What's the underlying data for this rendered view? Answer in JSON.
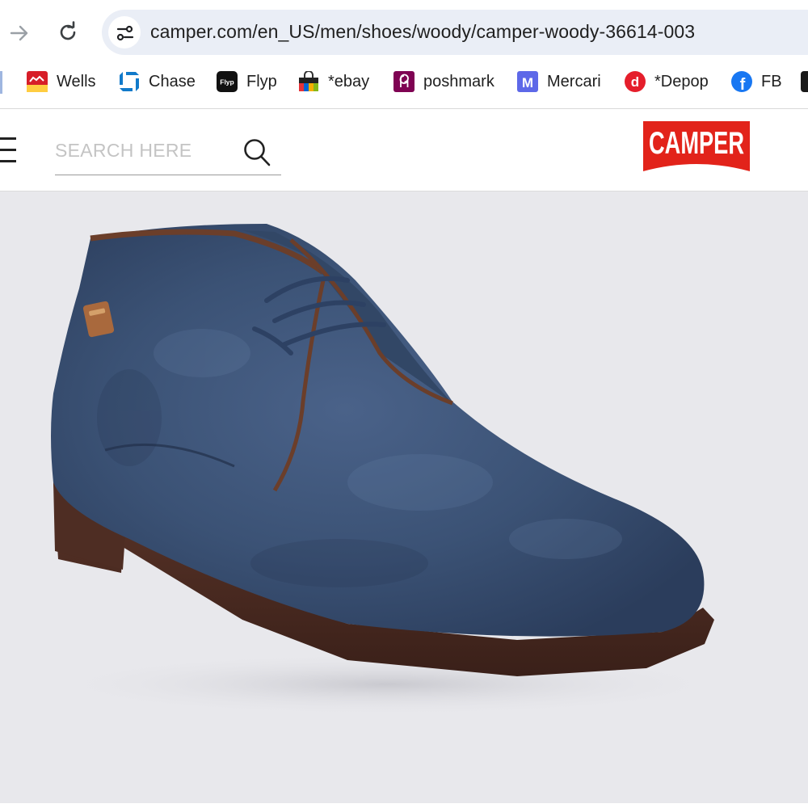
{
  "browser": {
    "url": "camper.com/en_US/men/shoes/woody/camper-woody-36614-003",
    "bookmarks": [
      {
        "label": "Wells",
        "icon": "wells-fargo-icon"
      },
      {
        "label": "Chase",
        "icon": "chase-icon"
      },
      {
        "label": "Flyp",
        "icon": "flyp-icon",
        "icon_text": "Flyp"
      },
      {
        "label": "*ebay",
        "icon": "ebay-icon"
      },
      {
        "label": "poshmark",
        "icon": "poshmark-icon"
      },
      {
        "label": "Mercari",
        "icon": "mercari-icon",
        "icon_text": "M"
      },
      {
        "label": "*Depop",
        "icon": "depop-icon",
        "icon_text": "d"
      },
      {
        "label": "FB",
        "icon": "facebook-icon",
        "icon_text": "f"
      }
    ]
  },
  "site": {
    "search_placeholder": "SEARCH HERE",
    "logo_text": "CAMPER",
    "brand_color": "#e2231a"
  },
  "product": {
    "image": "navy-suede-chukka-boot",
    "suede_color": "#3a5074",
    "sole_color": "#4a2c22",
    "background": "#e8e8ec"
  }
}
